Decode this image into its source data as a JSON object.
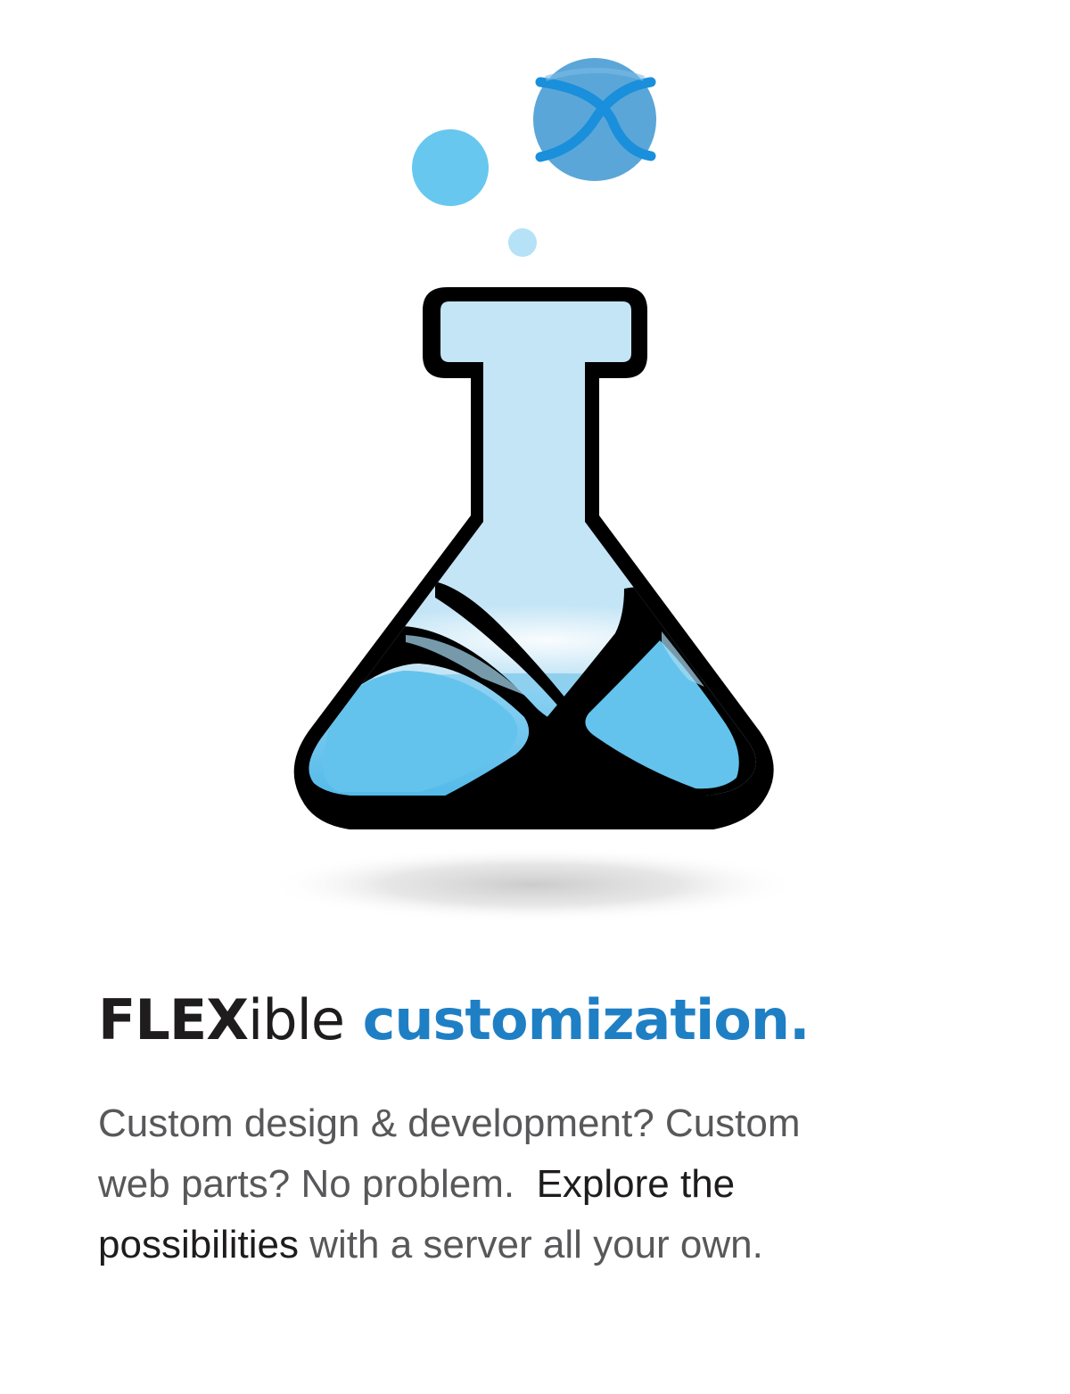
{
  "headline": {
    "part1_bold": "FLEX",
    "part1_light": "ible",
    "part2": "customization."
  },
  "body": {
    "line1": "Custom design & development? Custom",
    "line2_a": "web parts? No problem.",
    "line2_b": "Explore the",
    "line3_a": "possibilities",
    "line3_b": "with a server all your own."
  },
  "colors": {
    "headline_dark": "#1e1c1d",
    "headline_blue": "#1f7fc4",
    "body_gray": "#58585a",
    "flask_glass": "#c4e5f6",
    "liquid": "#63c3ec",
    "bubble_large": "#5ba6d8",
    "bubble_medium": "#67c7ef",
    "bubble_small": "#b5e2f6"
  },
  "icons": [
    "flask-icon",
    "bubble-icon",
    "x-logo-icon"
  ]
}
